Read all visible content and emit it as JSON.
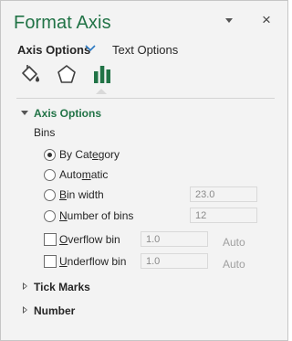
{
  "header": {
    "title": "Format Axis",
    "close_glyph": "×"
  },
  "tabs": {
    "axis_options": "Axis Options",
    "text_options": "Text Options"
  },
  "icons": [
    "fill-line-icon",
    "effects-icon",
    "axis-options-bars-icon"
  ],
  "colors": {
    "accent": "#217346",
    "pane": "#f3f3f3"
  },
  "sections": {
    "axis_options": "Axis Options",
    "tick_marks": "Tick Marks",
    "number": "Number"
  },
  "bins": {
    "label": "Bins",
    "options": [
      {
        "pre": "By Cat",
        "u": "e",
        "post": "gory",
        "selected": true
      },
      {
        "pre": "Auto",
        "u": "m",
        "post": "atic",
        "selected": false
      },
      {
        "pre": "",
        "u": "B",
        "post": "in width",
        "selected": false,
        "value": "23.0"
      },
      {
        "pre": "",
        "u": "N",
        "post": "umber of bins",
        "selected": false,
        "value": "12"
      }
    ],
    "overflow": {
      "pre": "",
      "u": "O",
      "post": "verflow bin",
      "checked": false,
      "value": "1.0",
      "auto": "Auto"
    },
    "underflow": {
      "pre": "",
      "u": "U",
      "post": "nderflow bin",
      "checked": false,
      "value": "1.0",
      "auto": "Auto"
    }
  }
}
